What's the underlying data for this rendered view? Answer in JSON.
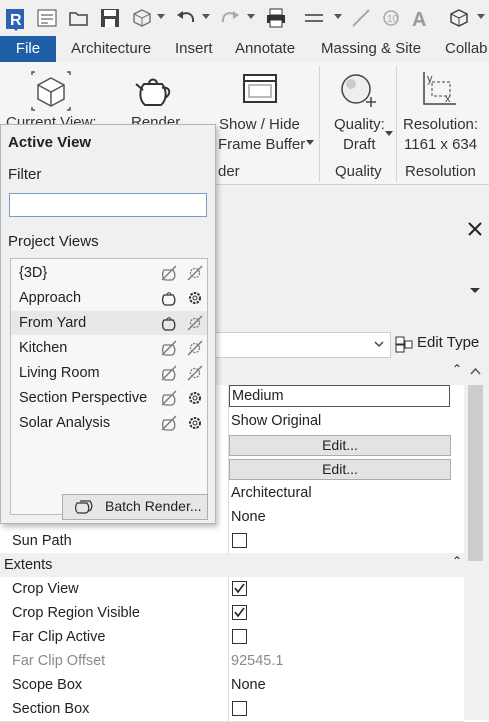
{
  "tabs": [
    "File",
    "Architecture",
    "Insert",
    "Annotate",
    "Massing & Site",
    "Collab"
  ],
  "ribbon": {
    "current_view": "Current View:",
    "render": "Render",
    "show_hide_1": "Show / Hide",
    "show_hide_2": "Frame Buffer",
    "quality_1": "Quality:",
    "quality_2": "Draft",
    "resolution_1": "Resolution:",
    "resolution_2": "1161 x 634",
    "group_render_partial": "der",
    "group_quality": "Quality",
    "group_resolution": "Resolution"
  },
  "popup": {
    "title": "Active View",
    "filter_label": "Filter",
    "filter_value": "",
    "project_views_label": "Project Views",
    "views": [
      {
        "name": "{3D}",
        "teapot_icon": "teapot-disabled-icon",
        "gear_icon": "gear-disabled-icon"
      },
      {
        "name": "Approach",
        "teapot_icon": "teapot-icon",
        "gear_icon": "gear-icon"
      },
      {
        "name": "From Yard",
        "teapot_icon": "teapot-icon",
        "gear_icon": "gear-disabled-icon"
      },
      {
        "name": "Kitchen",
        "teapot_icon": "teapot-disabled-icon",
        "gear_icon": "gear-disabled-icon"
      },
      {
        "name": "Living Room",
        "teapot_icon": "teapot-disabled-icon",
        "gear_icon": "gear-disabled-icon"
      },
      {
        "name": "Section Perspective",
        "teapot_icon": "teapot-disabled-icon",
        "gear_icon": "gear-icon"
      },
      {
        "name": "Solar Analysis",
        "teapot_icon": "teapot-disabled-icon",
        "gear_icon": "gear-icon"
      }
    ],
    "batch_render": "Batch Render..."
  },
  "properties": {
    "edit_type": "Edit Type",
    "values_top": [
      "Medium",
      "Show Original",
      "Edit...",
      "Edit...",
      "Architectural",
      "None"
    ],
    "rows": [
      {
        "label": "Sun Path",
        "value": "",
        "checked": false
      },
      {
        "label": "Extents",
        "group": true
      },
      {
        "label": "Crop View",
        "checked": true
      },
      {
        "label": "Crop Region Visible",
        "checked": true
      },
      {
        "label": "Far Clip Active",
        "checked": false
      },
      {
        "label": "Far Clip Offset",
        "value": "92545.1",
        "disabled": true
      },
      {
        "label": "Scope Box",
        "value": "None"
      },
      {
        "label": "Section Box",
        "checked": false
      }
    ]
  },
  "colors": {
    "file_tab": "#1e5fa8",
    "accent": "#1e5fa8"
  }
}
